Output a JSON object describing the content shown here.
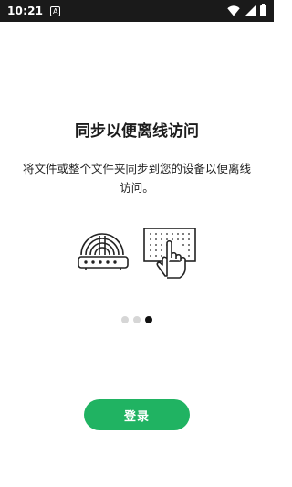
{
  "status_bar": {
    "time": "10:21",
    "notification_icon": "A",
    "icons": [
      "wifi-icon",
      "signal-icon",
      "battery-icon"
    ]
  },
  "onboarding": {
    "title": "同步以便离线访问",
    "description": "将文件或整个文件夹同步到您的设备以便离线访问。",
    "page_count": 3,
    "active_page": 3,
    "illustration": [
      "router-icon",
      "tap-sync-icon"
    ]
  },
  "actions": {
    "login_label": "登录"
  },
  "colors": {
    "accent": "#20b362",
    "status_bar": "#1a1a1a"
  }
}
